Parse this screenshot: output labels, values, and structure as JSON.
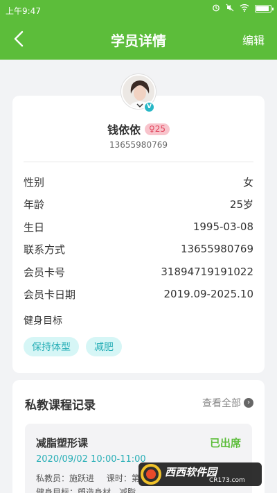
{
  "status": {
    "time": "上午9:47"
  },
  "nav": {
    "title": "学员详情",
    "edit": "编辑"
  },
  "profile": {
    "name": "钱依依",
    "age_badge": "♀25",
    "verify_mark": "V",
    "phone": "13655980769",
    "fields": [
      {
        "label": "性别",
        "value": "女"
      },
      {
        "label": "年龄",
        "value": "25岁"
      },
      {
        "label": "生日",
        "value": "1995-03-08"
      },
      {
        "label": "联系方式",
        "value": "13655980769"
      },
      {
        "label": "会员卡号",
        "value": "31894719191022"
      },
      {
        "label": "会员卡日期",
        "value": "2019.09-2025.10"
      }
    ],
    "goal_label": "健身目标",
    "goals": [
      "保持体型",
      "减肥"
    ]
  },
  "courses": {
    "title": "私教课程记录",
    "view_all": "查看全部",
    "records": [
      {
        "name": "减脂塑形课",
        "status": "已出席",
        "time": "2020/09/02 10:00-11:00",
        "coach_label": "私教员：施跃进",
        "hours_label": "课时：第",
        "goal_line": "健身目标：塑造身材、减脂"
      }
    ]
  },
  "watermark": {
    "brand": "西西软件园",
    "url": "CR173.com"
  },
  "colors": {
    "primary": "#5cbd3a",
    "tag_text": "#27aeb6",
    "tag_bg": "#d6f6f6",
    "badge": "#e0425a"
  }
}
